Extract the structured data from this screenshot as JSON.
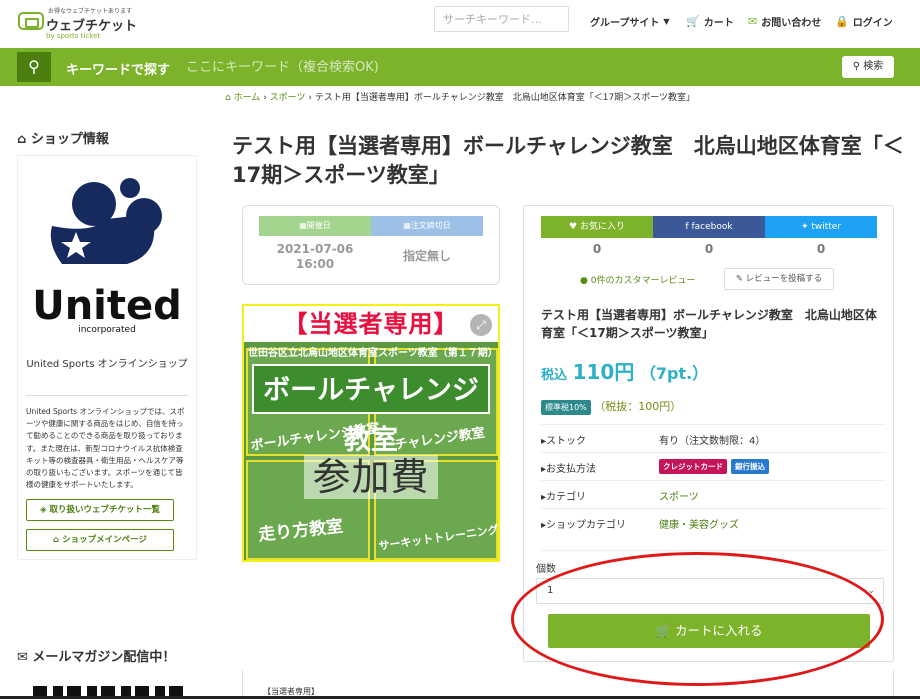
{
  "header": {
    "logo_tagline": "お得なウェブチケットあります",
    "logo_name": "ウェブチケット",
    "logo_sub": "by sports ticket",
    "search_placeholder": "サーチキーワード…",
    "nav": [
      {
        "label": "グループサイト",
        "icon": "caret-down-icon"
      },
      {
        "label": "カート",
        "icon": "cart-icon"
      },
      {
        "label": "お問い合わせ",
        "icon": "mail-icon"
      },
      {
        "label": "ログイン",
        "icon": "lock-icon"
      }
    ]
  },
  "search_bar": {
    "label": "キーワードで探す",
    "placeholder": "ここにキーワード（複合検索OK)",
    "button": "検索"
  },
  "breadcrumb": [
    "ホーム",
    "スポーツ",
    "テスト用【当選者専用】ボールチャレンジ教室　北烏山地区体育室「＜17期＞スポーツ教室」"
  ],
  "sidebar": {
    "shop_heading": "ショップ情報",
    "logo_word": "United",
    "logo_sub": "incorporated",
    "shop_name": "United Sports オンラインショップ",
    "shop_desc": "United Sports オンラインショップでは、スポーツや健康に関する商品をはじめ、自信を持って勧めることのできる商品を取り扱っております。また現在は、新型コロナウイルス抗体検査キット等の検査器具・衛生用品・ヘルスケア等の取り扱いもございます。スポーツを通じて皆様の健康をサポートいたします。",
    "button_tickets": "取り扱いウェブチケット一覧",
    "button_main": "ショップメインページ",
    "newsletter_heading": "メールマガジン配信中！"
  },
  "product": {
    "title": "テスト用【当選者専用】ボールチャレンジ教室　北烏山地区体育室「＜17期＞スポーツ教室」",
    "event_date_label": "開催日",
    "deadline_label": "注文締切日",
    "event_date": "2021-07-06\n16:00",
    "deadline": "指定無し",
    "image": {
      "top": "【当選者専用】",
      "title": "ボールチャレンジ教室",
      "fee": "参加費",
      "panel_top": "世田谷区立北烏山地区体育室スポーツ教室（第１７期）",
      "panel_a": "ボールチャレンジ教室",
      "panel_b": "チャレンジ教室",
      "panel_c": "走り方教室",
      "panel_d": "サーキットトレーニング教室"
    },
    "social": [
      {
        "label": "お気に入り",
        "count": "0",
        "color": "#7cb32a"
      },
      {
        "label": "facebook",
        "count": "0",
        "color": "#3b5998"
      },
      {
        "label": "twitter",
        "count": "0",
        "color": "#1da1f2"
      }
    ],
    "reviews": "0件のカスタマーレビュー",
    "post_review": "レビューを投稿する",
    "price_prefix": "税込",
    "price": "110円",
    "points": "（7pt.）",
    "tax_badge": "標準税10%",
    "tax_excl": "（税抜：100円）",
    "specs": [
      {
        "label": "ストック",
        "value": "有り（注文数制限：4）"
      },
      {
        "label": "お支払方法",
        "value": ""
      },
      {
        "label": "カテゴリ",
        "value": "スポーツ"
      },
      {
        "label": "ショップカテゴリ",
        "value": "健康・美容グッズ"
      }
    ],
    "payment_methods": [
      {
        "label": "クレジットカード",
        "color": "#c4145a"
      },
      {
        "label": "銀行振込",
        "color": "#2a79d0"
      }
    ],
    "quantity_label": "個数",
    "quantity_value": "1",
    "cart_button": "カートに入れる",
    "desc_start": "【当選者専用】"
  }
}
